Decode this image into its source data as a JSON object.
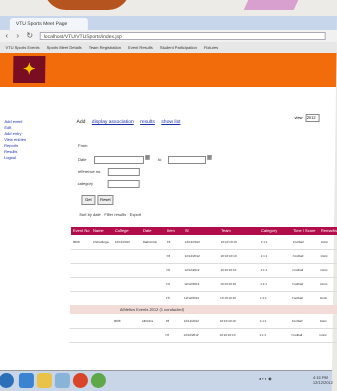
{
  "browser": {
    "tab_title": "VTU Sports Meet Page",
    "url": "localhost/VTU/VTUSports/index.jsp",
    "bookmarks": [
      "VTU Sports Events",
      "Sports Meet Details",
      "Team Registration",
      "Event Results",
      "Student Participation",
      "Fixtures"
    ]
  },
  "page": {
    "sidebar": [
      "Add event",
      "Edit",
      "Add entry",
      "View entries",
      "Reports",
      "Results",
      "Logout"
    ],
    "action_links": [
      "Add",
      "display association",
      "results",
      "show list"
    ],
    "select_label": "view",
    "select_value": "2012",
    "form": {
      "from_label": "From",
      "date_label": "Date",
      "to_label": "to",
      "reference_label": "reference no.",
      "category_label": "category",
      "button_1": "Get",
      "button_2": "Reset"
    },
    "table_controls": "Sort by date · Filter results · Export",
    "table_headers": [
      "Event No",
      "Name",
      "College",
      "Date",
      "Item",
      "Sl",
      "Team",
      "Category",
      "Time / Score",
      "Remarks"
    ],
    "rows": [
      [
        "0008",
        "Chitradurga",
        "12/12/2012",
        "Badminton",
        "F8",
        "12/12/2012",
        "10:10:10:10",
        "1:1:1",
        "Football",
        "Done"
      ],
      [
        "",
        "",
        "",
        "",
        "F8",
        "12/12/2012",
        "10:10:10:10",
        "1:1:1",
        "Football",
        "Done"
      ],
      [
        "",
        "",
        "",
        "",
        "F8",
        "12/12/2012",
        "10:10:10:10",
        "1:1:1",
        "Football",
        "Done"
      ],
      [
        "",
        "",
        "",
        "",
        "F8",
        "12/12/2012",
        "10:10:10:10",
        "1:1:1",
        "Football",
        "Done"
      ],
      [
        "",
        "",
        "",
        "",
        "F8",
        "12/12/2012",
        "10:10:10:10",
        "1:1:1",
        "Football",
        "Done"
      ]
    ],
    "group_label": "Athletics Events 2012 (1 conducted)",
    "rows2": [
      [
        "",
        "",
        "0008",
        "Athletics",
        "F8",
        "12/12/2012",
        "10:10:10:10",
        "1:1:1",
        "Football",
        "Done"
      ],
      [
        "",
        "",
        "",
        "",
        "F8",
        "12/12/2012",
        "10:10:10:10",
        "1:1:1",
        "Football",
        "Done"
      ]
    ]
  },
  "taskbar": {
    "clock_time": "4:16 PM",
    "clock_date": "12/12/2012"
  }
}
